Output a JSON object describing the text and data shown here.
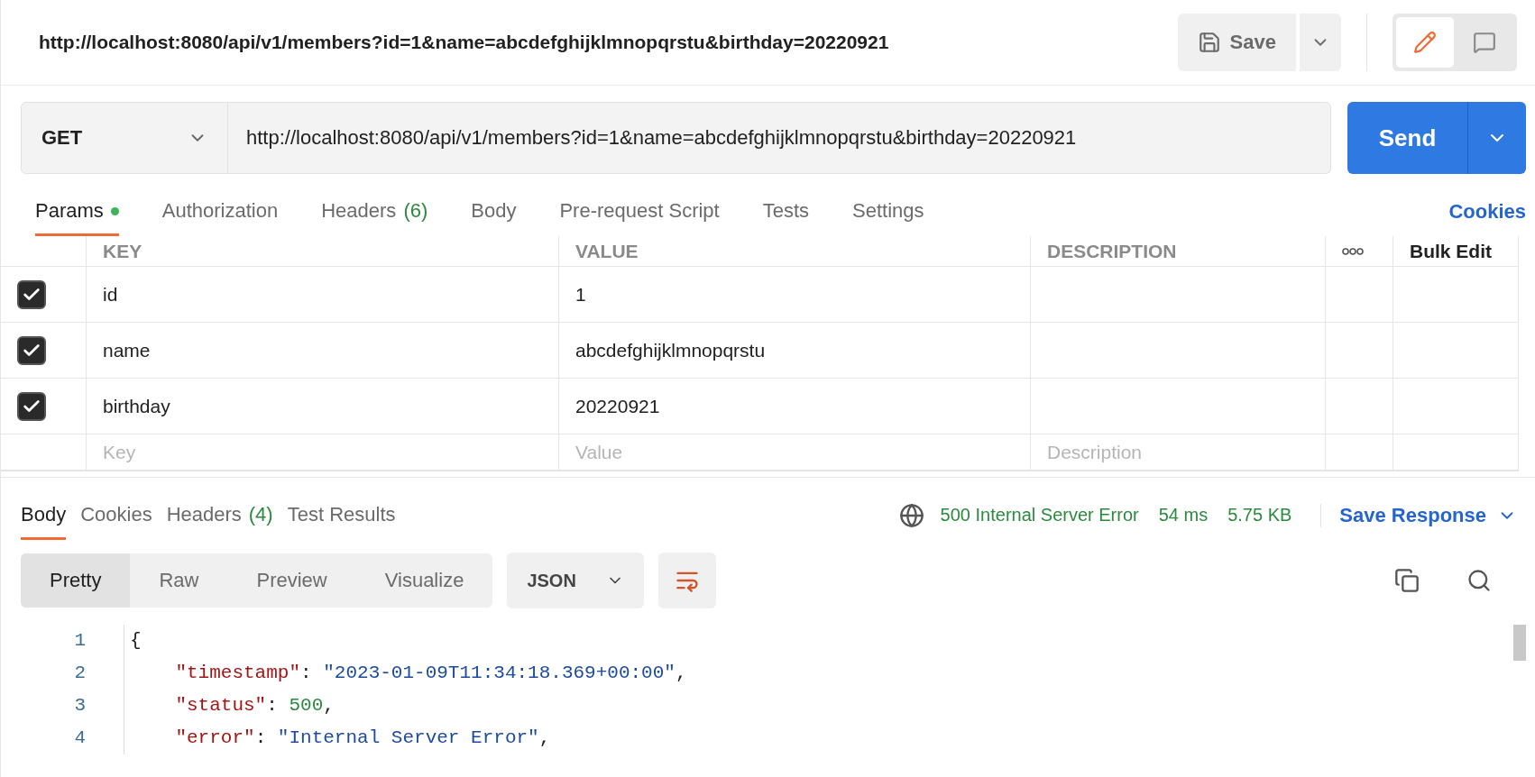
{
  "title": "http://localhost:8080/api/v1/members?id=1&name=abcdefghijklmnopqrstu&birthday=20220921",
  "save_button": {
    "label": "Save"
  },
  "mode_toggle": [
    {
      "kind": "edit",
      "selected": true
    },
    {
      "kind": "comment",
      "selected": false
    }
  ],
  "request": {
    "method": "GET",
    "url": "http://localhost:8080/api/v1/members?id=1&name=abcdefghijklmnopqrstu&birthday=20220921",
    "send_label": "Send"
  },
  "request_tabs": [
    {
      "label": "Params",
      "selected": true,
      "dot": true
    },
    {
      "label": "Authorization",
      "selected": false,
      "dot": false
    },
    {
      "label": "Headers",
      "count": "(6)",
      "selected": false,
      "dot": false
    },
    {
      "label": "Body",
      "selected": false,
      "dot": false
    },
    {
      "label": "Pre-request Script",
      "selected": false,
      "dot": false
    },
    {
      "label": "Tests",
      "selected": false,
      "dot": false
    },
    {
      "label": "Settings",
      "selected": false,
      "dot": false
    }
  ],
  "cookies_link": "Cookies",
  "params": {
    "columns": [
      "KEY",
      "VALUE",
      "DESCRIPTION"
    ],
    "bulk_edit": "Bulk Edit",
    "rows": [
      {
        "key": "id",
        "value": "1",
        "checked": true
      },
      {
        "key": "name",
        "value": "abcdefghijklmnopqrstu",
        "checked": true
      },
      {
        "key": "birthday",
        "value": "20220921",
        "checked": true
      }
    ],
    "placeholders": {
      "key": "Key",
      "value": "Value",
      "description": "Description"
    }
  },
  "response": {
    "tabs": [
      {
        "label": "Body",
        "selected": true
      },
      {
        "label": "Cookies",
        "selected": false
      },
      {
        "label": "Headers",
        "count": "(4)",
        "selected": false
      },
      {
        "label": "Test Results",
        "selected": false
      }
    ],
    "status": "500 Internal Server Error",
    "time": "54 ms",
    "size": "5.75 KB",
    "save_response": "Save Response",
    "views": [
      {
        "label": "Pretty",
        "selected": true
      },
      {
        "label": "Raw",
        "selected": false
      },
      {
        "label": "Preview",
        "selected": false
      },
      {
        "label": "Visualize",
        "selected": false
      }
    ],
    "format": "JSON",
    "code": [
      {
        "number": "1",
        "tokens": [
          {
            "kind": "punct",
            "text": "{"
          }
        ]
      },
      {
        "number": "2",
        "tokens": [
          {
            "kind": "key",
            "text": "    \"timestamp\""
          },
          {
            "kind": "punct",
            "text": ": "
          },
          {
            "kind": "string",
            "text": "\"2023-01-09T11:34:18.369+00:00\""
          },
          {
            "kind": "punct",
            "text": ","
          }
        ]
      },
      {
        "number": "3",
        "tokens": [
          {
            "kind": "key",
            "text": "    \"status\""
          },
          {
            "kind": "punct",
            "text": ": "
          },
          {
            "kind": "number",
            "text": "500"
          },
          {
            "kind": "punct",
            "text": ","
          }
        ]
      },
      {
        "number": "4",
        "tokens": [
          {
            "kind": "key",
            "text": "    \"error\""
          },
          {
            "kind": "punct",
            "text": ": "
          },
          {
            "kind": "string",
            "text": "\"Internal Server Error\""
          },
          {
            "kind": "punct",
            "text": ","
          }
        ]
      }
    ]
  }
}
